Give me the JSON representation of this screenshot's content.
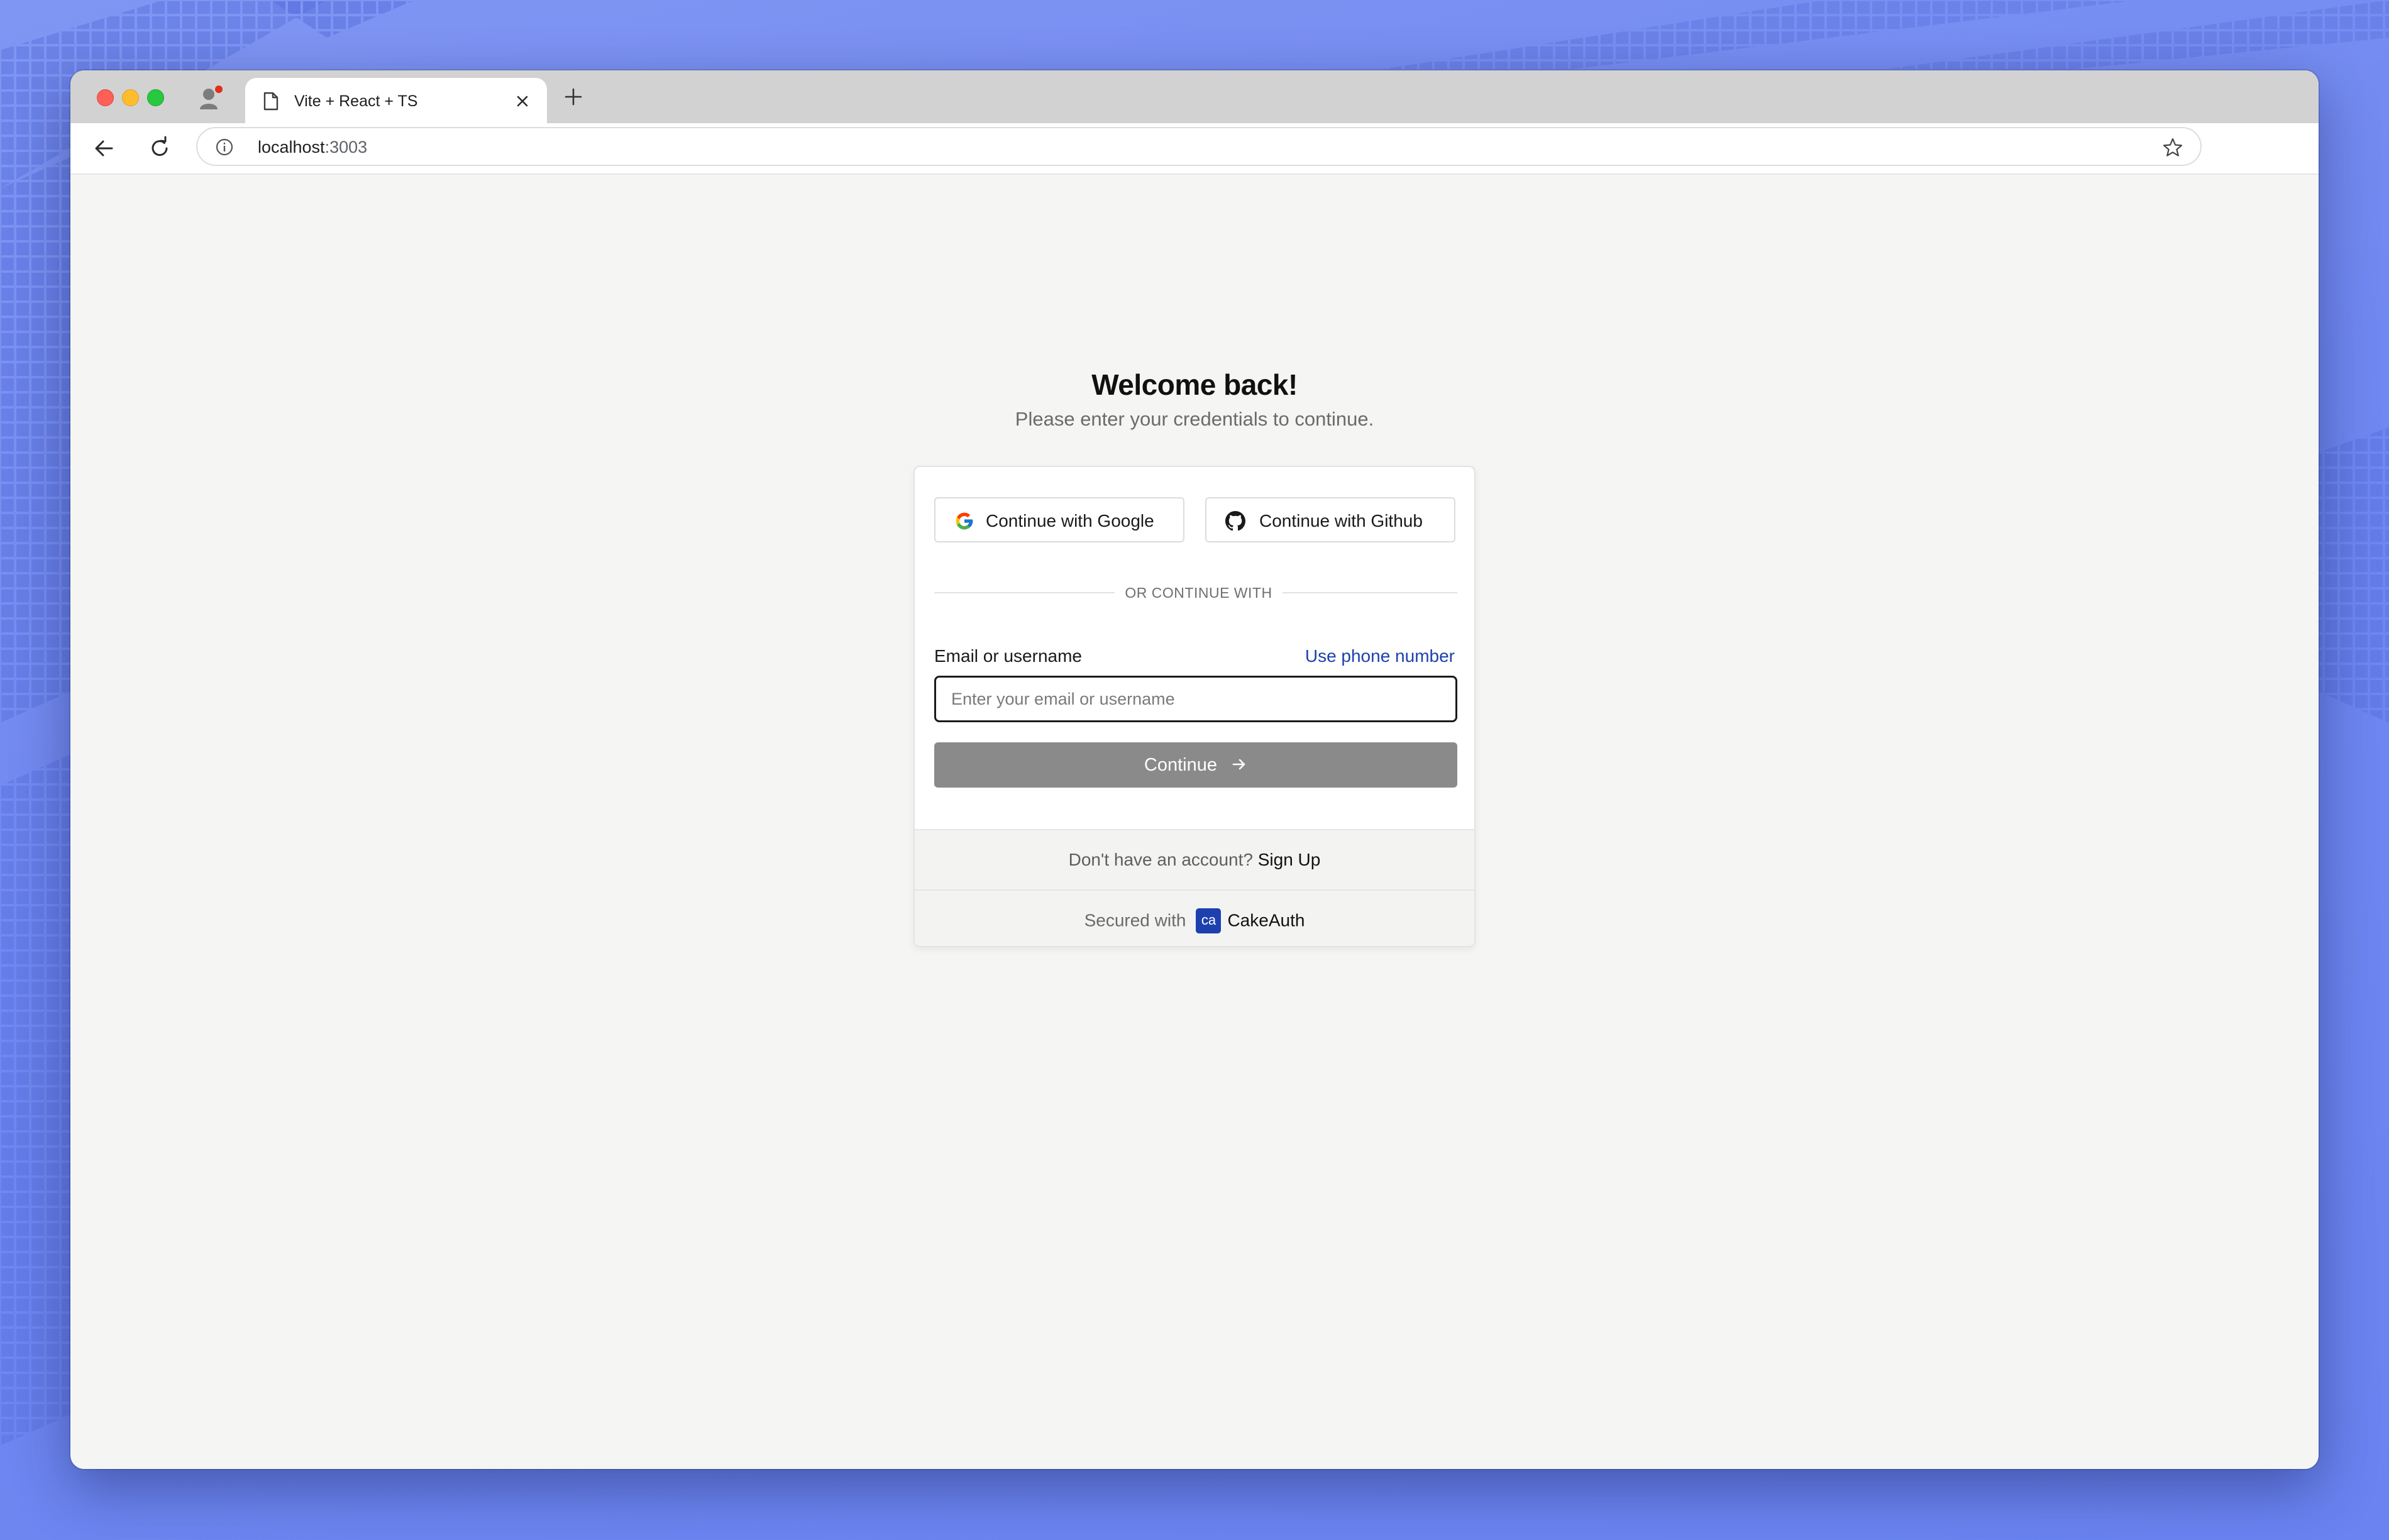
{
  "browser": {
    "tab_title": "Vite + React + TS",
    "url_host": "localhost",
    "url_port": ":3003"
  },
  "page": {
    "title": "Welcome back!",
    "subtitle": "Please enter your credentials to continue."
  },
  "oauth": {
    "google_label": "Continue with Google",
    "github_label": "Continue with Github"
  },
  "divider": "OR CONTINUE WITH",
  "form": {
    "email_label": "Email or username",
    "phone_link": "Use phone number",
    "email_placeholder": "Enter your email or username",
    "email_value": "",
    "continue_label": "Continue"
  },
  "footer": {
    "signup_prompt": "Don't have an account? ",
    "signup_link": "Sign Up",
    "secured_prefix": "Secured with",
    "brand_logo_text": "ca",
    "brand_name": "CakeAuth"
  },
  "icons": {
    "profile": "profile-icon",
    "tab": "file-icon",
    "close": "close-icon",
    "new_tab": "plus-icon",
    "back": "arrow-left-icon",
    "reload": "reload-icon",
    "info": "info-icon",
    "bookmark": "star-icon",
    "google": "google-icon",
    "github": "github-icon",
    "continue": "arrow-right-icon"
  },
  "colors": {
    "desktop_bg": "#7088f1",
    "accent_link": "#1e40af",
    "continue_button": "#8a8a8a",
    "page_bg": "#f5f5f4",
    "traffic_red": "#fe5f57",
    "traffic_yellow": "#febc2e",
    "traffic_green": "#28c840"
  }
}
